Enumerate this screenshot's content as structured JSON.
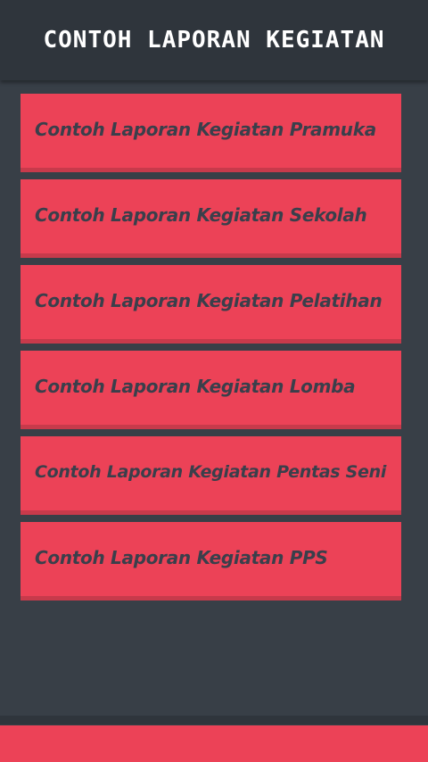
{
  "app": {
    "title": "Contoh Laporan Kegiatan"
  },
  "menu": {
    "items": [
      {
        "label": "Contoh Laporan Kegiatan Pramuka"
      },
      {
        "label": "Contoh Laporan Kegiatan Sekolah"
      },
      {
        "label": "Contoh Laporan Kegiatan Pelatihan"
      },
      {
        "label": "Contoh Laporan Kegiatan Lomba"
      },
      {
        "label": "Contoh Laporan Kegiatan Pentas Seni"
      },
      {
        "label": "Contoh Laporan Kegiatan PPS"
      }
    ]
  },
  "colors": {
    "background": "#383f47",
    "header": "#2f353c",
    "accent": "#ec4257",
    "accent_shadow": "#c73a4b",
    "label_text": "#3a3f4b",
    "title_text": "#ffffff"
  }
}
